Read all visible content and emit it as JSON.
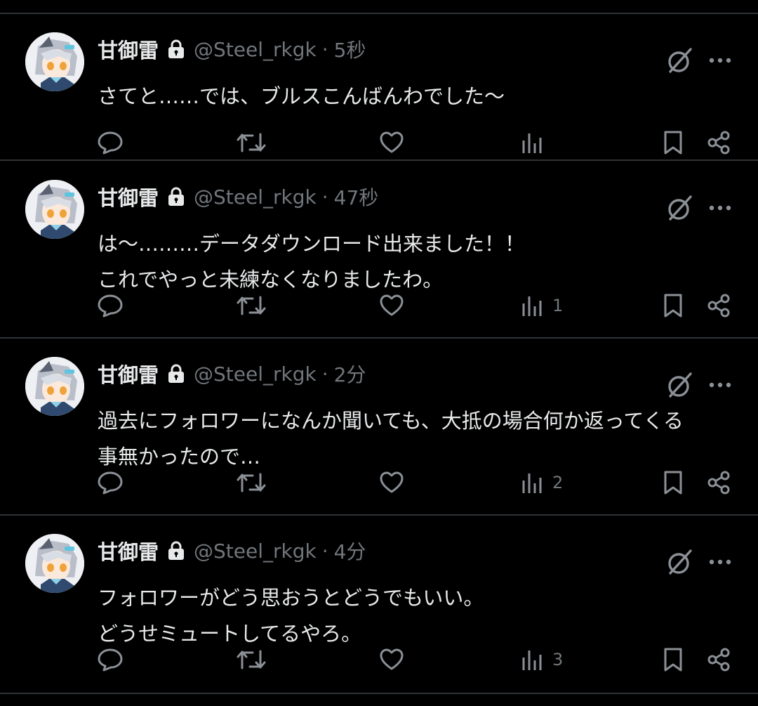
{
  "tweets": [
    {
      "display_name": "甘御雷",
      "handle": "@Steel_rkgk",
      "separator": "·",
      "time": "5秒",
      "lines": [
        "さてと……では、ブルスこんばんわでした〜"
      ],
      "views": ""
    },
    {
      "display_name": "甘御雷",
      "handle": "@Steel_rkgk",
      "separator": "·",
      "time": "47秒",
      "lines": [
        "は〜………データダウンロード出来ました！！",
        "これでやっと未練なくなりましたわ。"
      ],
      "views": "1"
    },
    {
      "display_name": "甘御雷",
      "handle": "@Steel_rkgk",
      "separator": "·",
      "time": "2分",
      "lines": [
        "過去にフォロワーになんか聞いても、大抵の場合何か返ってくる",
        "事無かったので…"
      ],
      "views": "2"
    },
    {
      "display_name": "甘御雷",
      "handle": "@Steel_rkgk",
      "separator": "·",
      "time": "4分",
      "lines": [
        "フォロワーがどう思おうとどうでもいい。",
        "どうせミュートしてるやろ。"
      ],
      "views": "3"
    }
  ],
  "icons": {
    "lock": "lock-icon",
    "grok": "grok-icon",
    "more": "more-icon",
    "reply": "reply-icon",
    "retweet": "retweet-icon",
    "like": "like-icon",
    "views": "views-icon",
    "bookmark": "bookmark-icon",
    "share": "share-icon"
  },
  "colors": {
    "background": "#000000",
    "text": "#e7e9ea",
    "secondary": "#71767b",
    "divider": "#2f3336"
  }
}
